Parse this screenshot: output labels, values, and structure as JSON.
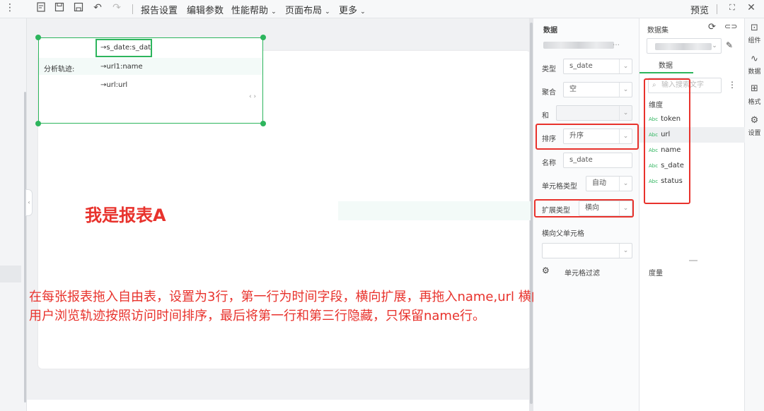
{
  "toolbar": {
    "menus": [
      "报告设置",
      "编辑参数",
      "性能帮助",
      "页面布局",
      "更多"
    ],
    "preview": "预览"
  },
  "free_table": {
    "rows": [
      {
        "label": "",
        "value": "→s_date:s_dat"
      },
      {
        "label": "分析轨迹:",
        "value": "→url1:name"
      },
      {
        "label": "",
        "value": "→url:url"
      }
    ]
  },
  "annotation": {
    "report_name": "我是报表A",
    "note": "在每张报表拖入自由表，设置为3行，第一行为时间字段，横向扩展，再拖入name,url 横向父单元格选择s_date，目的是将用户浏览轨迹按照访问时间排序，最后将第一行和第三行隐藏，只保留name行。"
  },
  "properties": {
    "section": "数据",
    "type_label": "类型",
    "type_value": "s_date",
    "agg_label": "聚合",
    "agg_value": "空",
    "sum_label": "和",
    "sort_label": "排序",
    "sort_value": "升序",
    "name_label": "名称",
    "name_value": "s_date",
    "cell_type_label": "单元格类型",
    "cell_type_value": "自动",
    "expand_label": "扩展类型",
    "expand_value": "横向",
    "parent_label": "横向父单元格",
    "filter_label": "单元格过滤"
  },
  "dataset": {
    "title": "数据集",
    "tab": "数据",
    "search_placeholder": "输入搜索文字",
    "dimension": "维度",
    "fields": [
      "token",
      "url",
      "name",
      "s_date",
      "status"
    ],
    "selected": "url",
    "measure": "度量"
  },
  "right_bar": {
    "items": [
      "组件",
      "数据",
      "格式",
      "设置"
    ]
  },
  "colors": {
    "accent_green": "#2db55d",
    "annotation_red": "#e8322c"
  }
}
